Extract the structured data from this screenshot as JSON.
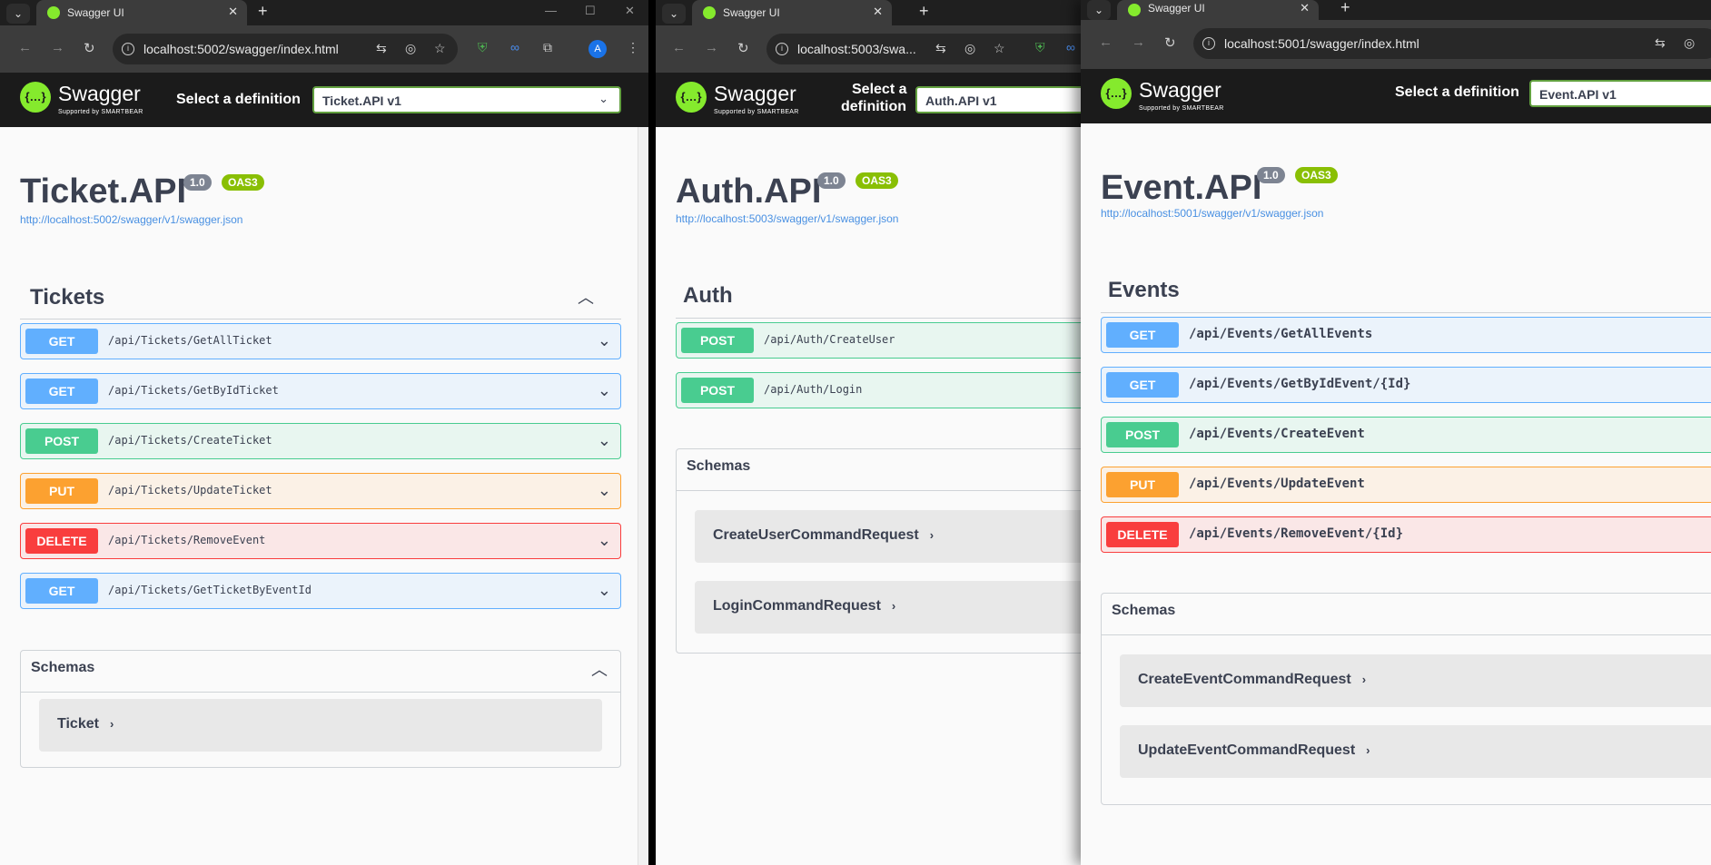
{
  "windows": [
    {
      "tab_title": "Swagger UI",
      "url": "localhost:5002/swagger/index.html",
      "select_label": "Select a definition",
      "definition": "Ticket.API v1",
      "api_title": "Ticket.API",
      "version": "1.0",
      "oas": "OAS3",
      "spec_url": "http://localhost:5002/swagger/v1/swagger.json",
      "tag": "Tickets",
      "ops": [
        {
          "method": "GET",
          "path": "/api/Tickets/GetAllTicket"
        },
        {
          "method": "GET",
          "path": "/api/Tickets/GetByIdTicket"
        },
        {
          "method": "POST",
          "path": "/api/Tickets/CreateTicket"
        },
        {
          "method": "PUT",
          "path": "/api/Tickets/UpdateTicket"
        },
        {
          "method": "DELETE",
          "path": "/api/Tickets/RemoveEvent"
        },
        {
          "method": "GET",
          "path": "/api/Tickets/GetTicketByEventId"
        }
      ],
      "schemas_label": "Schemas",
      "models": [
        "Ticket"
      ]
    },
    {
      "tab_title": "Swagger UI",
      "url": "localhost:5003/swa...",
      "select_label_1": "Select a",
      "select_label_2": "definition",
      "definition": "Auth.API v1",
      "api_title": "Auth.API",
      "version": "1.0",
      "oas": "OAS3",
      "spec_url": "http://localhost:5003/swagger/v1/swagger.json",
      "tag": "Auth",
      "ops": [
        {
          "method": "POST",
          "path": "/api/Auth/CreateUser"
        },
        {
          "method": "POST",
          "path": "/api/Auth/Login"
        }
      ],
      "schemas_label": "Schemas",
      "models": [
        "CreateUserCommandRequest",
        "LoginCommandRequest"
      ]
    },
    {
      "tab_title": "Swagger UI",
      "url": "localhost:5001/swagger/index.html",
      "select_label": "Select a definition",
      "definition": "Event.API v1",
      "api_title": "Event.API",
      "version": "1.0",
      "oas": "OAS3",
      "spec_url": "http://localhost:5001/swagger/v1/swagger.json",
      "tag": "Events",
      "ops": [
        {
          "method": "GET",
          "path": "/api/Events/GetAllEvents"
        },
        {
          "method": "GET",
          "path": "/api/Events/GetByIdEvent/{Id}"
        },
        {
          "method": "POST",
          "path": "/api/Events/CreateEvent"
        },
        {
          "method": "PUT",
          "path": "/api/Events/UpdateEvent"
        },
        {
          "method": "DELETE",
          "path": "/api/Events/RemoveEvent/{Id}"
        }
      ],
      "schemas_label": "Schemas",
      "models": [
        "CreateEventCommandRequest",
        "UpdateEventCommandRequest"
      ]
    }
  ],
  "brand": {
    "name": "Swagger",
    "sub": "Supported by SMARTBEAR"
  },
  "profile_initial": "A",
  "icons": {
    "tab_menu": "chevron-down-icon",
    "favicon": "swagger-favicon-icon",
    "close": "close-icon",
    "new_tab": "plus-icon",
    "back": "arrow-left-icon",
    "forward": "arrow-right-icon",
    "reload": "reload-icon",
    "info": "info-icon",
    "translate": "translate-icon",
    "lens": "google-lens-icon",
    "bookmark": "star-icon",
    "extensions": "puzzle-icon",
    "menu": "kebab-menu-icon"
  },
  "colors": {
    "get": "#61affe",
    "post": "#49cc90",
    "put": "#fca130",
    "delete": "#f93e3e",
    "swagger_green": "#85ea2d",
    "topbar": "#1b1b1b",
    "link": "#4990e2"
  }
}
